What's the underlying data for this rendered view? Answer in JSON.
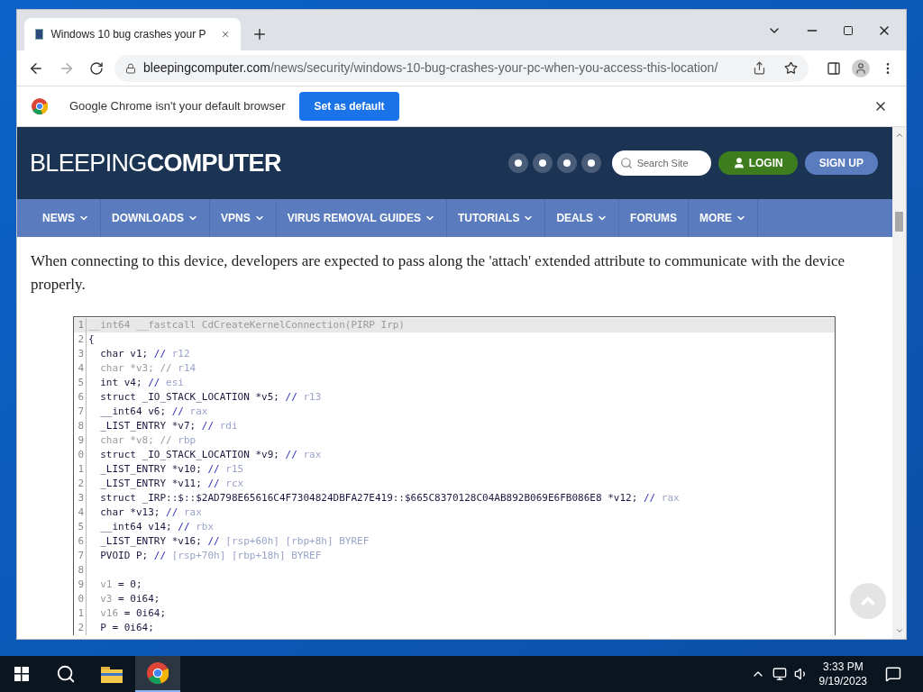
{
  "browser": {
    "tab": {
      "title": "Windows 10 bug crashes your P",
      "selected": true
    },
    "url": {
      "domain": "bleepingcomputer.com",
      "path": "/news/security/windows-10-bug-crashes-your-pc-when-you-access-this-location/"
    },
    "infobar": {
      "message": "Google Chrome isn't your default browser",
      "button": "Set as default"
    }
  },
  "site": {
    "logo_light": "BLEEPING",
    "logo_bold": "COMPUTER",
    "search": {
      "placeholder": "Search Site"
    },
    "login": "LOGIN",
    "signup": "SIGN UP",
    "nav": [
      {
        "label": "NEWS",
        "dropdown": true
      },
      {
        "label": "DOWNLOADS",
        "dropdown": true
      },
      {
        "label": "VPNS",
        "dropdown": true
      },
      {
        "label": "VIRUS REMOVAL GUIDES",
        "dropdown": true
      },
      {
        "label": "TUTORIALS",
        "dropdown": true
      },
      {
        "label": "DEALS",
        "dropdown": true
      },
      {
        "label": "FORUMS",
        "dropdown": false
      },
      {
        "label": "MORE",
        "dropdown": true
      }
    ]
  },
  "article": {
    "paragraph": "When connecting to this device, developers are expected to pass along the 'attach' extended attribute to communicate with the device properly.",
    "code": [
      {
        "num": "1",
        "highlighted": true,
        "parts": [
          {
            "text": "__int64 __fastcall CdCreateKernelConnection(PIRP Irp)",
            "kind": "muted"
          }
        ]
      },
      {
        "num": "2",
        "highlighted": false,
        "parts": [
          {
            "text": "{",
            "kind": "code"
          }
        ]
      },
      {
        "num": "3",
        "highlighted": false,
        "parts": [
          {
            "text": "  char v1; ",
            "kind": "code"
          },
          {
            "text": "// ",
            "kind": "slash"
          },
          {
            "text": "r12",
            "kind": "comment"
          }
        ]
      },
      {
        "num": "4",
        "highlighted": false,
        "parts": [
          {
            "text": "  char *v3; // ",
            "kind": "muted"
          },
          {
            "text": "r14",
            "kind": "comment"
          }
        ]
      },
      {
        "num": "5",
        "highlighted": false,
        "parts": [
          {
            "text": "  int v4; ",
            "kind": "code"
          },
          {
            "text": "// ",
            "kind": "slash"
          },
          {
            "text": "esi",
            "kind": "comment"
          }
        ]
      },
      {
        "num": "6",
        "highlighted": false,
        "parts": [
          {
            "text": "  struct _IO_STACK_LOCATION *v5; ",
            "kind": "code"
          },
          {
            "text": "// ",
            "kind": "slash"
          },
          {
            "text": "r13",
            "kind": "comment"
          }
        ]
      },
      {
        "num": "7",
        "highlighted": false,
        "parts": [
          {
            "text": "  __int64 v6; ",
            "kind": "code"
          },
          {
            "text": "// ",
            "kind": "slash"
          },
          {
            "text": "rax",
            "kind": "comment"
          }
        ]
      },
      {
        "num": "8",
        "highlighted": false,
        "parts": [
          {
            "text": "  _LIST_ENTRY *v7; ",
            "kind": "code"
          },
          {
            "text": "// ",
            "kind": "slash"
          },
          {
            "text": "rdi",
            "kind": "comment"
          }
        ]
      },
      {
        "num": "9",
        "highlighted": false,
        "parts": [
          {
            "text": "  char *v8; // ",
            "kind": "muted"
          },
          {
            "text": "rbp",
            "kind": "comment"
          }
        ]
      },
      {
        "num": "0",
        "highlighted": false,
        "parts": [
          {
            "text": "  struct _IO_STACK_LOCATION *v9; ",
            "kind": "code"
          },
          {
            "text": "// ",
            "kind": "slash"
          },
          {
            "text": "rax",
            "kind": "comment"
          }
        ]
      },
      {
        "num": "1",
        "highlighted": false,
        "parts": [
          {
            "text": "  _LIST_ENTRY *v10; ",
            "kind": "code"
          },
          {
            "text": "// ",
            "kind": "slash"
          },
          {
            "text": "r15",
            "kind": "comment"
          }
        ]
      },
      {
        "num": "2",
        "highlighted": false,
        "parts": [
          {
            "text": "  _LIST_ENTRY *v11; ",
            "kind": "code"
          },
          {
            "text": "// ",
            "kind": "slash"
          },
          {
            "text": "rcx",
            "kind": "comment"
          }
        ]
      },
      {
        "num": "3",
        "highlighted": false,
        "parts": [
          {
            "text": "  struct _IRP::$::$2AD798E65616C4F7304824DBFA27E419::$665C8370128C04AB892B069E6FB086E8 *v12; ",
            "kind": "code"
          },
          {
            "text": "// ",
            "kind": "slash"
          },
          {
            "text": "rax",
            "kind": "comment"
          }
        ]
      },
      {
        "num": "4",
        "highlighted": false,
        "parts": [
          {
            "text": "  char *v13; ",
            "kind": "code"
          },
          {
            "text": "// ",
            "kind": "slash"
          },
          {
            "text": "rax",
            "kind": "comment"
          }
        ]
      },
      {
        "num": "5",
        "highlighted": false,
        "parts": [
          {
            "text": "  __int64 v14; ",
            "kind": "code"
          },
          {
            "text": "// ",
            "kind": "slash"
          },
          {
            "text": "rbx",
            "kind": "comment"
          }
        ]
      },
      {
        "num": "6",
        "highlighted": false,
        "parts": [
          {
            "text": "  _LIST_ENTRY *v16; ",
            "kind": "code"
          },
          {
            "text": "// ",
            "kind": "slash"
          },
          {
            "text": "[rsp+60h] [rbp+8h] BYREF",
            "kind": "comment"
          }
        ]
      },
      {
        "num": "7",
        "highlighted": false,
        "parts": [
          {
            "text": "  PVOID P; ",
            "kind": "code"
          },
          {
            "text": "// ",
            "kind": "slash"
          },
          {
            "text": "[rsp+70h] [rbp+18h] BYREF",
            "kind": "comment"
          }
        ]
      },
      {
        "num": "8",
        "highlighted": false
      },
      {
        "num": "9",
        "highlighted": false,
        "parts": [
          {
            "text": "  v1",
            "kind": "muted"
          },
          {
            "text": " = 0;",
            "kind": "code"
          }
        ]
      },
      {
        "num": "0",
        "highlighted": false,
        "parts": [
          {
            "text": "  v3",
            "kind": "muted"
          },
          {
            "text": " = 0i64;",
            "kind": "code"
          }
        ]
      },
      {
        "num": "1",
        "highlighted": false,
        "parts": [
          {
            "text": "  v16",
            "kind": "muted"
          },
          {
            "text": " = 0i64;",
            "kind": "code"
          }
        ]
      },
      {
        "num": "2",
        "highlighted": false,
        "parts": [
          {
            "text": "  P = 0i64;",
            "kind": "code"
          }
        ]
      }
    ]
  },
  "taskbar": {
    "time": "3:33 PM",
    "date": "9/19/2023"
  }
}
